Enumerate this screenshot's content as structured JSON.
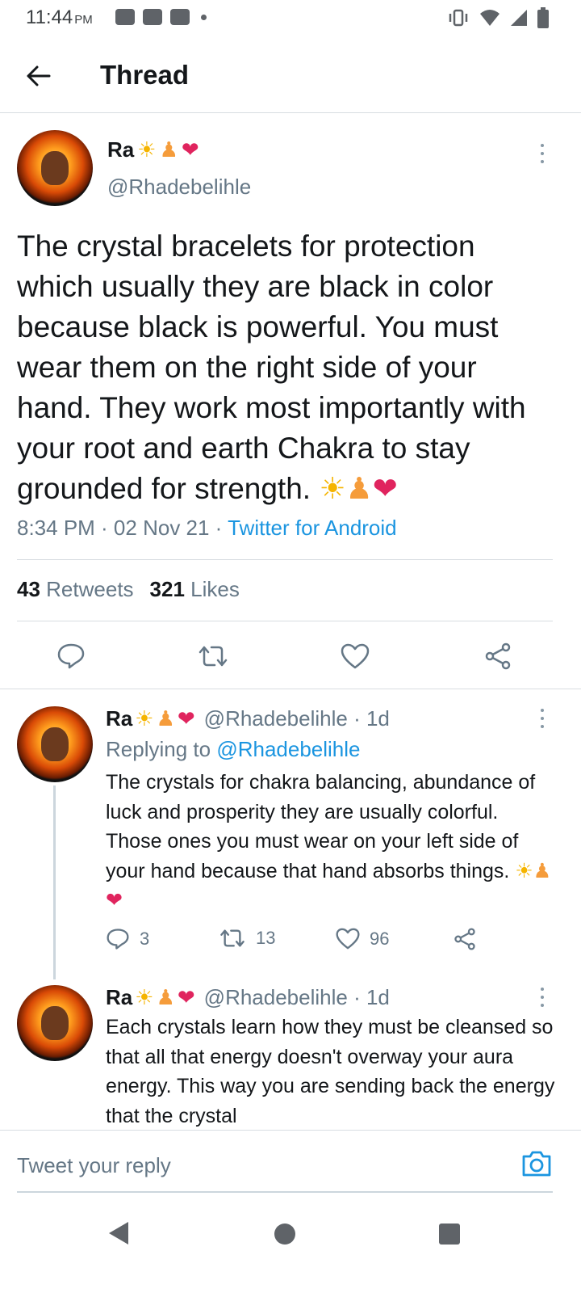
{
  "status_bar": {
    "time": "11:44",
    "ampm": "PM"
  },
  "header": {
    "title": "Thread",
    "back_icon": "arrow-left-icon"
  },
  "main_tweet": {
    "name": "Ra",
    "name_emojis": [
      "sun-emoji",
      "person-in-lotus-emoji",
      "red-heart-emoji"
    ],
    "handle": "@Rhadebelihle",
    "text": "The crystal bracelets for protection which usually they are black in color because black is powerful. You must wear them on the right side of your hand. They work most importantly with your root and earth Chakra to stay grounded for strength.",
    "text_emojis": [
      "sun-emoji",
      "person-in-lotus-emoji",
      "red-heart-emoji"
    ],
    "timestamp": "8:34 PM · 02 Nov 21 · ",
    "source": "Twitter for Android",
    "retweets_count": "43",
    "retweets_label": "Retweets",
    "likes_count": "321",
    "likes_label": "Likes"
  },
  "replies": [
    {
      "name": "Ra",
      "handle": "@Rhadebelihle · 1d",
      "replying_prefix": "Replying to ",
      "replying_to": "@Rhadebelihle",
      "text": "The crystals for chakra balancing, abundance of luck and prosperity they are usually colorful. Those ones you must wear on your left side of your hand because that hand absorbs things.",
      "reply_count": "3",
      "retweet_count": "13",
      "like_count": "96"
    },
    {
      "name": "Ra",
      "handle": "@Rhadebelihle · 1d",
      "text": "Each crystals learn how they must be cleansed so that all that energy doesn't overway your aura energy. This way you are sending back the energy that the crystal"
    }
  ],
  "compose": {
    "placeholder": "Tweet your reply"
  },
  "colors": {
    "link": "#1b95e0",
    "secondary_text": "#657786",
    "divider": "#d8dde1"
  }
}
